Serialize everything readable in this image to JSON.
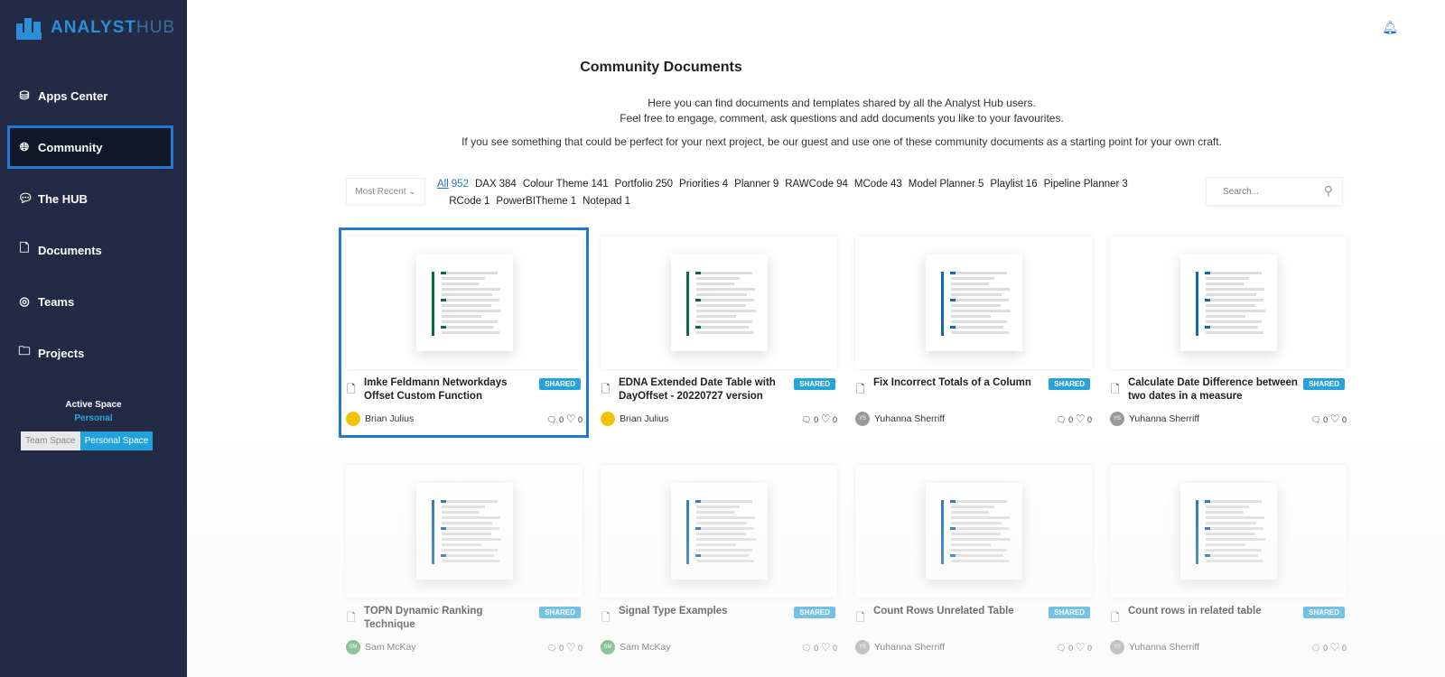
{
  "app": {
    "logo_main": "ANALYST",
    "logo_sub": "HUB"
  },
  "sidebar": {
    "items": [
      {
        "label": "Apps Center",
        "icon": "layers-icon"
      },
      {
        "label": "Community",
        "icon": "globe-icon",
        "active": true
      },
      {
        "label": "The HUB",
        "icon": "chat-icon"
      },
      {
        "label": "Documents",
        "icon": "document-icon"
      },
      {
        "label": "Teams",
        "icon": "user-circle-icon"
      },
      {
        "label": "Projects",
        "icon": "folder-icon"
      }
    ],
    "active_space_label": "Active Space",
    "active_space_value": "Personal",
    "team_space": "Team Space",
    "personal_space": "Personal Space"
  },
  "header": {
    "title": "Community Documents",
    "intro1": "Here you can find documents and templates shared by all the Analyst Hub users.",
    "intro2": "Feel free to engage, comment, ask questions and add documents you like to your favourites.",
    "intro3": "If you see something that could be perfect for your next project, be our guest and use one of these community documents as a starting point for your own craft."
  },
  "toolbar": {
    "sort": "Most Recent",
    "search_placeholder": "Search...",
    "filters": [
      {
        "label": "All",
        "count": "952"
      },
      {
        "label": "DAX",
        "count": "384"
      },
      {
        "label": "Colour Theme",
        "count": "141"
      },
      {
        "label": "Portfolio",
        "count": "250"
      },
      {
        "label": "Priorities",
        "count": "4"
      },
      {
        "label": "Planner",
        "count": "9"
      },
      {
        "label": "RAWCode",
        "count": "94"
      },
      {
        "label": "MCode",
        "count": "43"
      },
      {
        "label": "Model Planner",
        "count": "5"
      },
      {
        "label": "Playlist",
        "count": "16"
      },
      {
        "label": "Pipeline Planner",
        "count": "3"
      },
      {
        "label": "RCode",
        "count": "1"
      },
      {
        "label": "PowerBITheme",
        "count": "1"
      },
      {
        "label": "Notepad",
        "count": "1"
      }
    ]
  },
  "colors": {
    "accent": "#1f78d1",
    "badge": "#26a3da",
    "sidebar": "#232a45"
  },
  "cards": [
    {
      "title": "Imke Feldmann Networkdays Offset Custom Function",
      "badge": "SHARED",
      "author": "Brian Julius",
      "initials": "",
      "comments": "0",
      "likes": "0",
      "avatar": "#f2c200",
      "accent": "#0b6b3a"
    },
    {
      "title": "EDNA Extended Date Table with DayOffset - 20220727 version",
      "badge": "SHARED",
      "author": "Brian Julius",
      "initials": "",
      "comments": "0",
      "likes": "0",
      "avatar": "#f2c200",
      "accent": "#0b6b3a"
    },
    {
      "title": "Fix Incorrect Totals of a Column",
      "badge": "SHARED",
      "author": "Yuhanna Sherriff",
      "initials": "YS",
      "comments": "0",
      "likes": "0",
      "avatar": "#9a9a9a",
      "accent": "#1466b0"
    },
    {
      "title": "Calculate Date Difference between two dates in a measure",
      "badge": "SHARED",
      "author": "Yuhanna Sherriff",
      "initials": "YS",
      "comments": "0",
      "likes": "0",
      "avatar": "#9a9a9a",
      "accent": "#1466b0"
    },
    {
      "title": "TOPN Dynamic Ranking Technique",
      "badge": "SHARED",
      "author": "Sam McKay",
      "initials": "SM",
      "comments": "0",
      "likes": "0",
      "avatar": "#3a9a4a",
      "accent": "#1466b0"
    },
    {
      "title": "Signal Type Examples",
      "badge": "SHARED",
      "author": "Sam McKay",
      "initials": "SM",
      "comments": "0",
      "likes": "0",
      "avatar": "#3a9a4a",
      "accent": "#1466b0"
    },
    {
      "title": "Count Rows Unrelated Table",
      "badge": "SHARED",
      "author": "Yuhanna Sherriff",
      "initials": "YS",
      "comments": "0",
      "likes": "0",
      "avatar": "#9a9a9a",
      "accent": "#1466b0"
    },
    {
      "title": "Count rows in related table",
      "badge": "SHARED",
      "author": "Yuhanna Sherriff",
      "initials": "YS",
      "comments": "0",
      "likes": "0",
      "avatar": "#9a9a9a",
      "accent": "#1466b0"
    }
  ]
}
